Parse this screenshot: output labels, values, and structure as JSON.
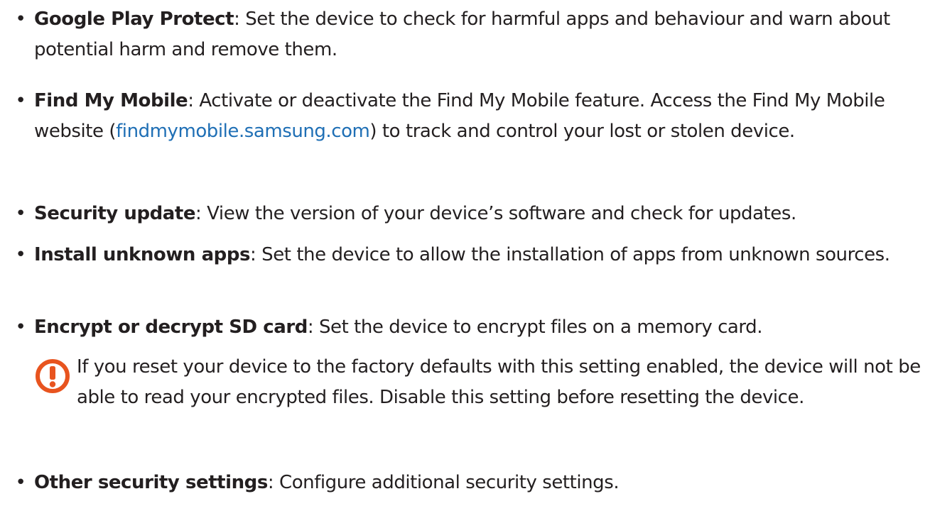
{
  "items": [
    {
      "term": "Google Play Protect",
      "desc": ": Set the device to check for harmful apps and behaviour and warn about potential harm and remove them."
    },
    {
      "term": "Find My Mobile",
      "desc_before": ": Activate or deactivate the Find My Mobile feature. Access the Find My Mobile website (",
      "link": "findmymobile.samsung.com",
      "desc_after": ") to track and control your lost or stolen device."
    },
    {
      "term": "Security update",
      "desc": ": View the version of your device’s software and check for updates."
    },
    {
      "term": "Install unknown apps",
      "desc": ": Set the device to allow the installation of apps from unknown sources."
    },
    {
      "term": "Encrypt or decrypt SD card",
      "desc": ": Set the device to encrypt files on a memory card."
    },
    {
      "term": "Other security settings",
      "desc": ": Configure additional security settings."
    }
  ],
  "note": {
    "icon": "caution-icon",
    "text": "If you reset your device to the factory defaults with this setting enabled, the device will not be able to read your encrypted files. Disable this setting before resetting the device."
  },
  "bullet": "•",
  "colors": {
    "text": "#231f20",
    "link": "#1f6fb5",
    "caution": "#e8541f"
  }
}
